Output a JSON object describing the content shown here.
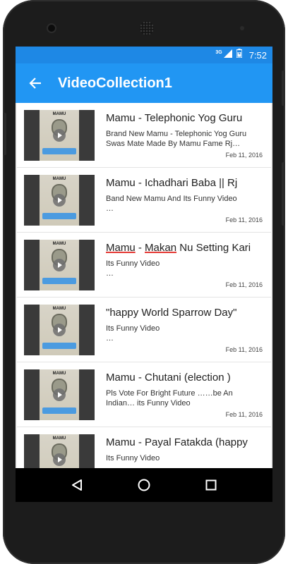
{
  "status_bar": {
    "network": "3G",
    "time": "7:52"
  },
  "app_bar": {
    "title": "VideoCollection1"
  },
  "videos": [
    {
      "title": "Mamu - Telephonic Yog Guru",
      "description": "Brand New Mamu - Telephonic Yog Guru Swas Mate Made By Mamu Fame Rj…",
      "date": "Feb 11, 2016"
    },
    {
      "title": "Mamu - Ichadhari Baba || Rj",
      "description": "Band New Mamu And Its Funny Video\n…",
      "date": "Feb 11, 2016"
    },
    {
      "title_parts": [
        "Mamu",
        " - ",
        "Makan",
        " Nu Setting Kari"
      ],
      "description": "Its Funny Video\n…",
      "date": "Feb 11, 2016"
    },
    {
      "title": "\"happy World Sparrow Day\"",
      "description": "Its Funny Video\n…",
      "date": "Feb 11, 2016"
    },
    {
      "title": "Mamu - Chutani (election )",
      "description": "Pls Vote For Bright Future ……be An Indian… its Funny Video",
      "date": "Feb 11, 2016"
    },
    {
      "title": "Mamu - Payal Fatakda (happy",
      "description": "Its Funny Video",
      "date": ""
    }
  ],
  "thumbnail": {
    "label": "MAMU"
  },
  "colors": {
    "status_bar": "#1e88e5",
    "app_bar": "#2196f3",
    "background": "#eeeeee",
    "nav_bar": "#000000"
  },
  "icons": {
    "back": "arrow-left-icon",
    "play": "play-icon",
    "nav_back": "triangle-back-icon",
    "nav_home": "circle-home-icon",
    "nav_recents": "square-recents-icon"
  }
}
